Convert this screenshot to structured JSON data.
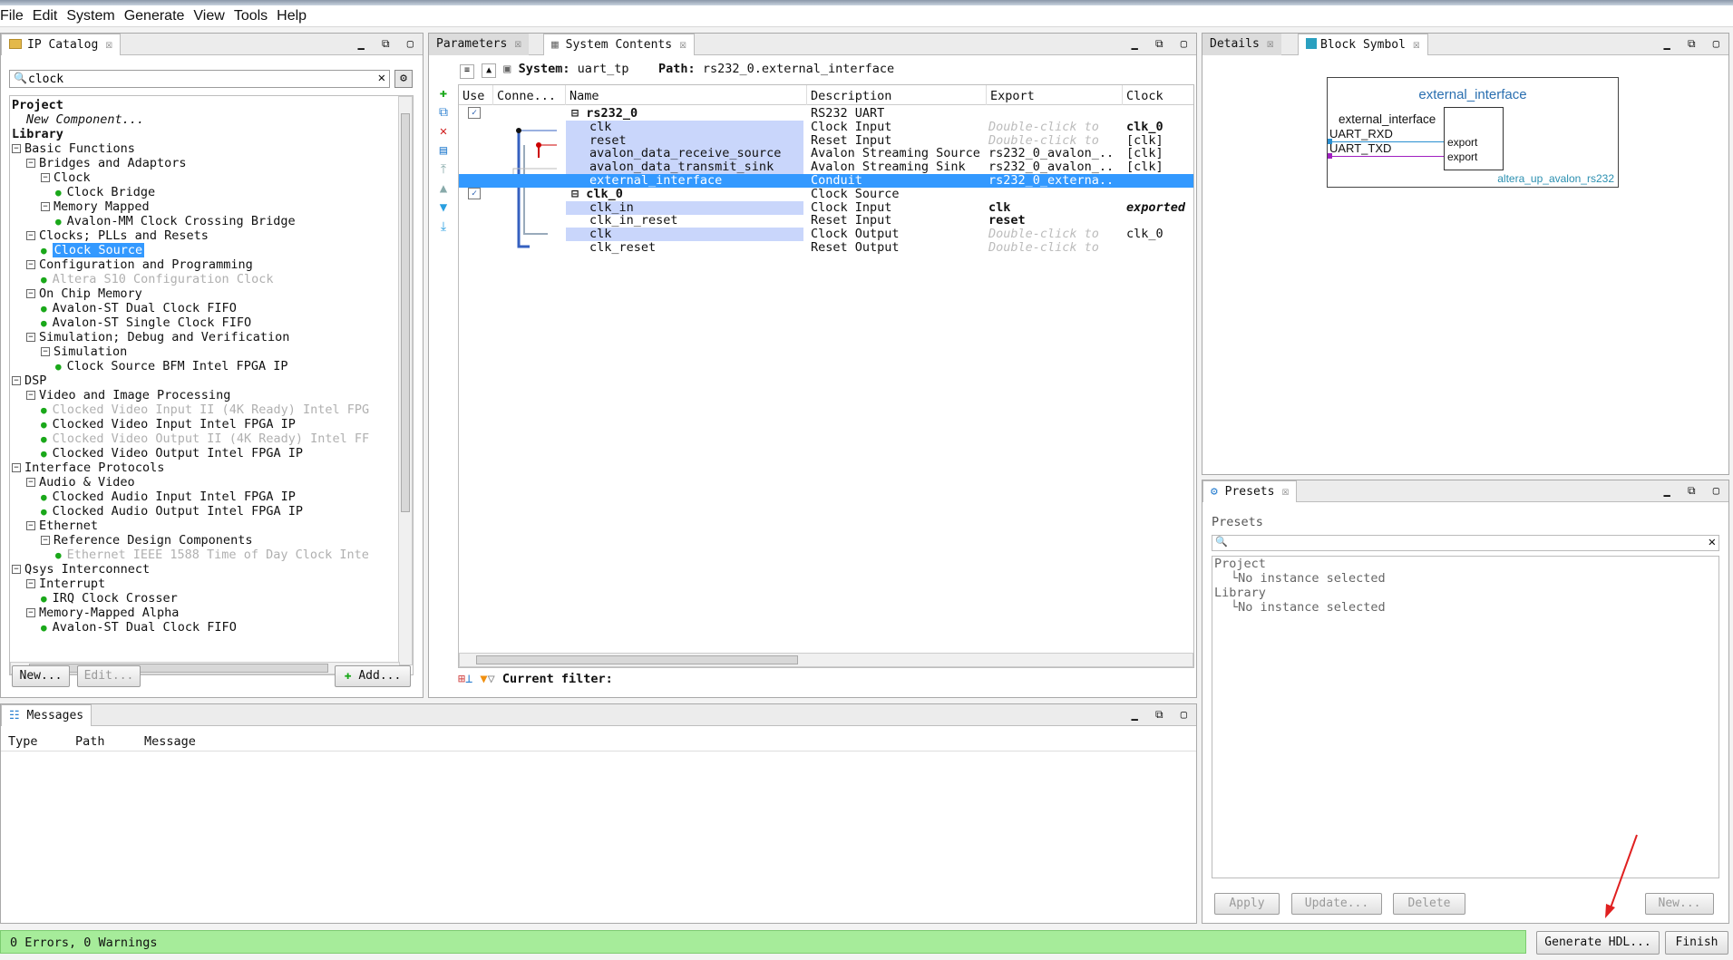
{
  "menu": [
    "File",
    "Edit",
    "System",
    "Generate",
    "View",
    "Tools",
    "Help"
  ],
  "ip_catalog": {
    "tab": "IP Catalog",
    "search_value": "clock",
    "tree": [
      {
        "text": "Project",
        "level": 0,
        "bold": true
      },
      {
        "text": "New Component...",
        "level": 1,
        "italic": true
      },
      {
        "text": "Library",
        "level": 0,
        "bold": true
      },
      {
        "text": "Basic Functions",
        "level": 0,
        "toggle": "-"
      },
      {
        "text": "Bridges and Adaptors",
        "level": 1,
        "toggle": "-"
      },
      {
        "text": "Clock",
        "level": 2,
        "toggle": "-"
      },
      {
        "text": "Clock Bridge",
        "level": 3,
        "dot": true
      },
      {
        "text": "Memory Mapped",
        "level": 2,
        "toggle": "-"
      },
      {
        "text": "Avalon-MM Clock Crossing Bridge",
        "level": 3,
        "dot": true
      },
      {
        "text": "Clocks; PLLs and Resets",
        "level": 1,
        "toggle": "-"
      },
      {
        "text": "Clock Source",
        "level": 2,
        "dot": true,
        "selected": true
      },
      {
        "text": "Configuration and Programming",
        "level": 1,
        "toggle": "-"
      },
      {
        "text": "Altera S10 Configuration Clock",
        "level": 2,
        "dot": true,
        "grey": true
      },
      {
        "text": "On Chip Memory",
        "level": 1,
        "toggle": "-"
      },
      {
        "text": "Avalon-ST Dual Clock FIFO",
        "level": 2,
        "dot": true
      },
      {
        "text": "Avalon-ST Single Clock FIFO",
        "level": 2,
        "dot": true
      },
      {
        "text": "Simulation; Debug and Verification",
        "level": 1,
        "toggle": "-"
      },
      {
        "text": "Simulation",
        "level": 2,
        "toggle": "-"
      },
      {
        "text": "Clock Source BFM Intel FPGA IP",
        "level": 3,
        "dot": true
      },
      {
        "text": "DSP",
        "level": 0,
        "toggle": "-"
      },
      {
        "text": "Video and Image Processing",
        "level": 1,
        "toggle": "-"
      },
      {
        "text": "Clocked Video Input II (4K Ready) Intel FPG",
        "level": 2,
        "dot": true,
        "grey": true
      },
      {
        "text": "Clocked Video Input Intel FPGA IP",
        "level": 2,
        "dot": true
      },
      {
        "text": "Clocked Video Output II (4K Ready) Intel FF",
        "level": 2,
        "dot": true,
        "grey": true
      },
      {
        "text": "Clocked Video Output Intel FPGA IP",
        "level": 2,
        "dot": true
      },
      {
        "text": "Interface Protocols",
        "level": 0,
        "toggle": "-"
      },
      {
        "text": "Audio & Video",
        "level": 1,
        "toggle": "-"
      },
      {
        "text": "Clocked Audio Input Intel FPGA IP",
        "level": 2,
        "dot": true
      },
      {
        "text": "Clocked Audio Output Intel FPGA IP",
        "level": 2,
        "dot": true
      },
      {
        "text": "Ethernet",
        "level": 1,
        "toggle": "-"
      },
      {
        "text": "Reference Design Components",
        "level": 2,
        "toggle": "-"
      },
      {
        "text": "Ethernet IEEE 1588 Time of Day Clock Inte",
        "level": 3,
        "dot": true,
        "grey": true
      },
      {
        "text": "Qsys Interconnect",
        "level": 0,
        "toggle": "-"
      },
      {
        "text": "Interrupt",
        "level": 1,
        "toggle": "-"
      },
      {
        "text": "IRQ Clock Crosser",
        "level": 2,
        "dot": true
      },
      {
        "text": "Memory-Mapped Alpha",
        "level": 1,
        "toggle": "-"
      },
      {
        "text": "Avalon-ST Dual Clock FIFO",
        "level": 2,
        "dot": true
      }
    ],
    "buttons": {
      "new": "New...",
      "edit": "Edit...",
      "add": "Add..."
    }
  },
  "system": {
    "tabs": [
      "Parameters",
      "System Contents"
    ],
    "system_label": "System:",
    "system_name": "uart_tp",
    "path_label": "Path:",
    "path_value": "rs232_0.external_interface",
    "columns": [
      "Use",
      "Conne...",
      "Name",
      "Description",
      "Export",
      "Clock"
    ],
    "rows": [
      {
        "name": "rs232_0",
        "desc": "RS232 UART",
        "export": "",
        "clock": "",
        "bold": true,
        "use": true,
        "header": true
      },
      {
        "name": "clk",
        "desc": "Clock Input",
        "export": "Double-click to",
        "clock": "clk_0",
        "exportHint": true,
        "clockBold": true,
        "sel": true
      },
      {
        "name": "reset",
        "desc": "Reset Input",
        "export": "Double-click to",
        "clock": "[clk]",
        "exportHint": true,
        "sel": true
      },
      {
        "name": "avalon_data_receive_source",
        "desc": "Avalon Streaming Source",
        "export": "rs232_0_avalon_...",
        "clock": "[clk]",
        "sel": true
      },
      {
        "name": "avalon_data_transmit_sink",
        "desc": "Avalon Streaming Sink",
        "export": "rs232_0_avalon_...",
        "clock": "[clk]",
        "sel": true
      },
      {
        "name": "external_interface",
        "desc": "Conduit",
        "export": "rs232_0_externa...",
        "clock": "",
        "hi": true
      },
      {
        "name": "clk_0",
        "desc": "Clock Source",
        "export": "",
        "clock": "",
        "bold": true,
        "use": true,
        "header": true
      },
      {
        "name": "clk_in",
        "desc": "Clock Input",
        "export": "clk",
        "clock": "exported",
        "exportBold": true,
        "clockItal": true,
        "sel": true
      },
      {
        "name": "clk_in_reset",
        "desc": "Reset Input",
        "export": "reset",
        "clock": "",
        "exportBold": true
      },
      {
        "name": "clk",
        "desc": "Clock Output",
        "export": "Double-click to",
        "clock": "clk_0",
        "exportHint": true,
        "sel": true
      },
      {
        "name": "clk_reset",
        "desc": "Reset Output",
        "export": "Double-click to",
        "clock": "",
        "exportHint": true
      }
    ],
    "filter_label": "Current filter:"
  },
  "details": {
    "tabs": [
      "Details",
      "Block Symbol"
    ],
    "symbol": {
      "title": "external_interface",
      "port_group": "external_interface",
      "ports": [
        "UART_RXD",
        "UART_TXD"
      ],
      "exports": [
        "export",
        "export"
      ],
      "component": "altera_up_avalon_rs232"
    }
  },
  "presets": {
    "tab": "Presets",
    "heading": "Presets",
    "tree": [
      {
        "text": "Project",
        "level": 0
      },
      {
        "text": "No instance selected",
        "level": 1
      },
      {
        "text": "Library",
        "level": 0
      },
      {
        "text": "No instance selected",
        "level": 1
      }
    ],
    "buttons": {
      "apply": "Apply",
      "update": "Update...",
      "delete": "Delete",
      "new": "New..."
    }
  },
  "messages": {
    "tab": "Messages",
    "columns": [
      "Type",
      "Path",
      "Message"
    ]
  },
  "status": {
    "text": "0 Errors, 0 Warnings"
  },
  "footer": {
    "generate": "Generate HDL...",
    "finish": "Finish"
  },
  "colors": {
    "status_bg": "#a6ec9a",
    "selection": "#3399ff",
    "row_select": "#c9d6fb",
    "symbol_blue": "#2a6fb0",
    "arrow": "#e02020"
  }
}
